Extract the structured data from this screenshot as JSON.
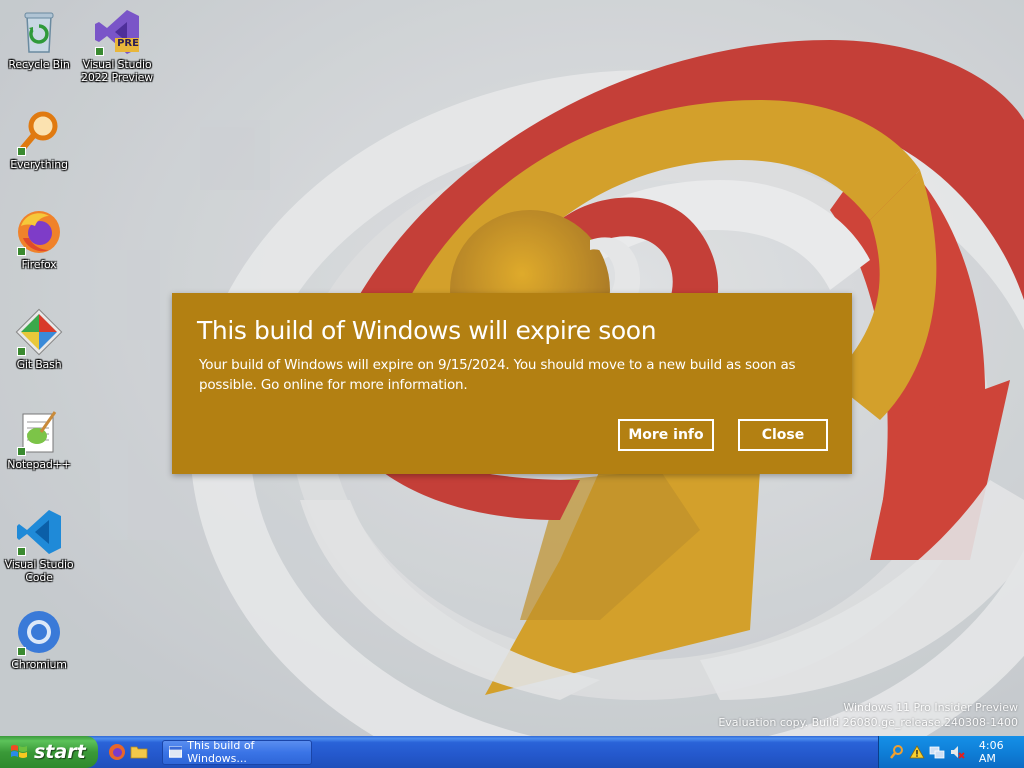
{
  "desktop": {
    "icons": [
      {
        "label": "Recycle Bin"
      },
      {
        "label": "Visual Studio 2022 Preview",
        "badge": "PRE"
      },
      {
        "label": "Everything"
      },
      {
        "label": "Firefox"
      },
      {
        "label": "Git Bash"
      },
      {
        "label": "Notepad++"
      },
      {
        "label": "Visual Studio Code"
      },
      {
        "label": "Chromium"
      }
    ],
    "watermark": {
      "line1": "Windows 11 Pro Insider Preview",
      "line2": "Evaluation copy. Build 26080.ge_release.240308-1400"
    }
  },
  "toast": {
    "title": "This build of Windows will expire soon",
    "body": "Your build of Windows will expire on 9/15/2024. You should move to a new build as soon as possible. Go online for more information.",
    "more_info_label": "More info",
    "close_label": "Close",
    "background": "#b38012"
  },
  "taskbar": {
    "start_label": "start",
    "quick_launch": [
      "firefox-icon",
      "folder-icon"
    ],
    "task_button_label": "This build of Windows...",
    "clock": "4:06 AM",
    "tray_icons": [
      "search-icon",
      "warning-icon",
      "network-icon",
      "volume-muted-icon"
    ]
  }
}
